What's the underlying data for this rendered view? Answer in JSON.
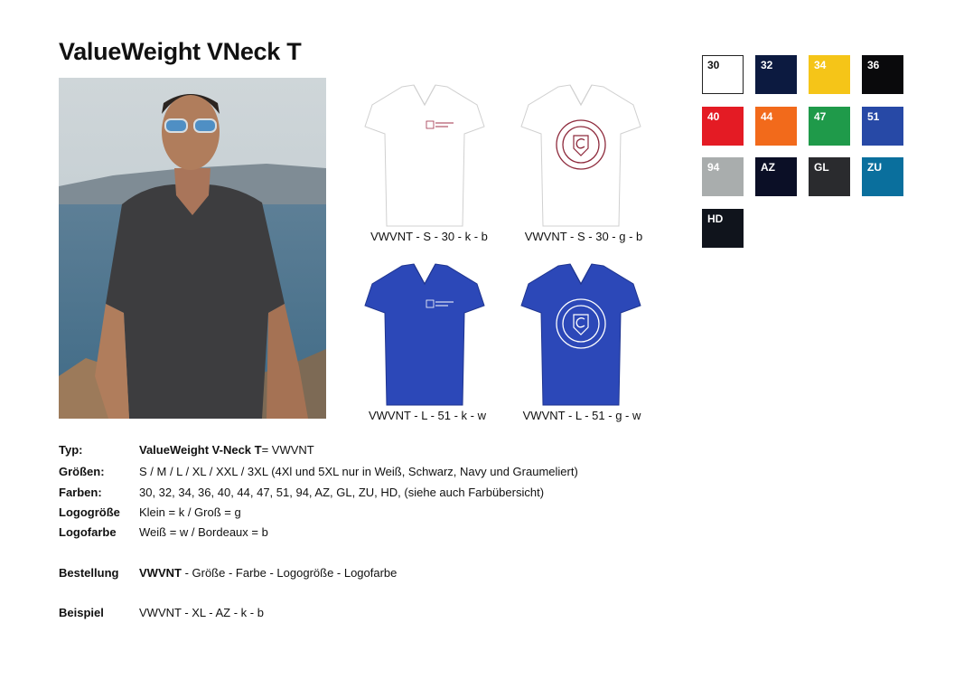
{
  "title": "ValueWeight VNeck T",
  "mockups": [
    {
      "caption": "VWVNT - S - 30 - k - b",
      "shirt_color": "#ffffff",
      "logo_color": "#a0304a",
      "logo_size": "small"
    },
    {
      "caption": "VWVNT - S - 30 - g - b",
      "shirt_color": "#ffffff",
      "logo_color": "#8e2a3c",
      "logo_size": "large"
    },
    {
      "caption": "VWVNT - L - 51 - k - w",
      "shirt_color": "#2c48b8",
      "logo_color": "#ffffff",
      "logo_size": "small"
    },
    {
      "caption": "VWVNT - L - 51 - g - w",
      "shirt_color": "#2c48b8",
      "logo_color": "#ffffff",
      "logo_size": "large"
    }
  ],
  "swatches": [
    {
      "code": "30",
      "color": "#ffffff"
    },
    {
      "code": "32",
      "color": "#0c1a40"
    },
    {
      "code": "34",
      "color": "#f5c518"
    },
    {
      "code": "36",
      "color": "#0a0a0c"
    },
    {
      "code": "40",
      "color": "#e41b24"
    },
    {
      "code": "44",
      "color": "#f26a1b"
    },
    {
      "code": "47",
      "color": "#1f9a4a"
    },
    {
      "code": "51",
      "color": "#2749a6"
    },
    {
      "code": "94",
      "color": "#a9adad"
    },
    {
      "code": "AZ",
      "color": "#0b0f26"
    },
    {
      "code": "GL",
      "color": "#2a2b2e"
    },
    {
      "code": "ZU",
      "color": "#0a6f9d"
    },
    {
      "code": "HD",
      "color": "#10141c"
    }
  ],
  "specs": {
    "typ_label": "Typ:",
    "typ_bold": "ValueWeight V-Neck T",
    "typ_rest": "= VWVNT",
    "groessen_label": "Größen:",
    "groessen_value": "S / M / L / XL / XXL  / 3XL (4Xl und 5XL nur in Weiß, Schwarz, Navy und Graumeliert)",
    "farben_label": "Farben:",
    "farben_value": "30, 32, 34, 36, 40, 44, 47, 51, 94, AZ, GL, ZU, HD,  (siehe auch Farbübersicht)",
    "logogroesse_label": "Logogröße",
    "logogroesse_value": "Klein = k / Groß = g",
    "logofarbe_label": "Logofarbe",
    "logofarbe_value": "Weiß = w / Bordeaux = b",
    "bestellung_label": "Bestellung",
    "bestellung_bold": "VWVNT",
    "bestellung_rest": " - Größe - Farbe - Logogröße - Logofarbe",
    "beispiel_label": "Beispiel",
    "beispiel_value": "VWVNT - XL - AZ - k - b"
  }
}
